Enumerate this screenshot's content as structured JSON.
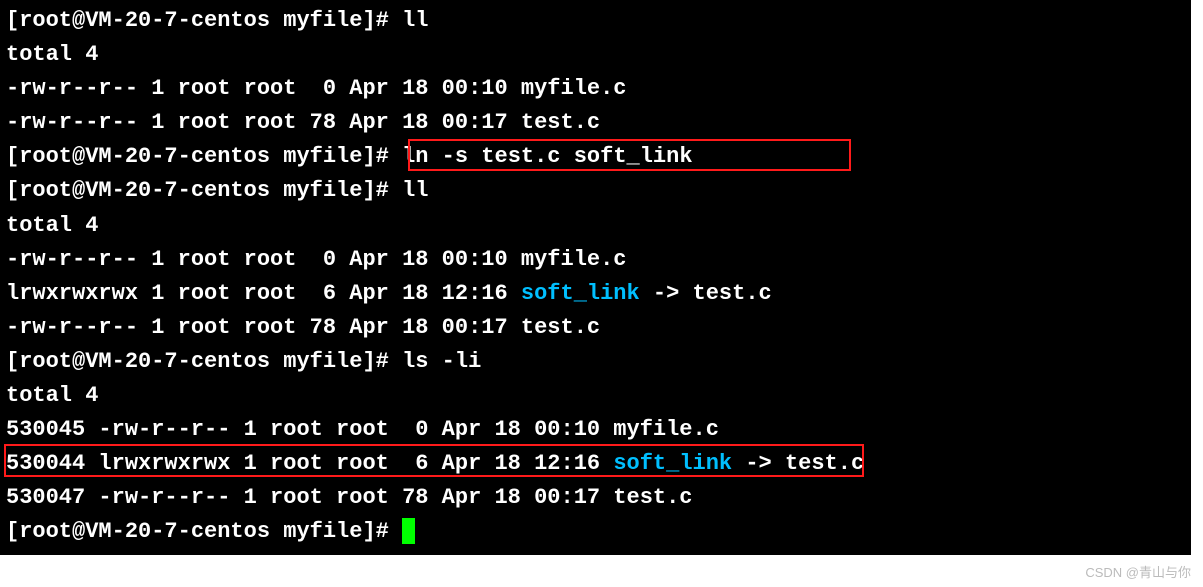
{
  "prompt": "[root@VM-20-7-centos myfile]# ",
  "cmd_ll1": "ll",
  "total": "total 4",
  "ls1_myfile": "-rw-r--r-- 1 root root  0 Apr 18 00:10 myfile.c",
  "ls1_test": "-rw-r--r-- 1 root root 78 Apr 18 00:17 test.c",
  "cmd_ln": "ln -s test.c soft_link",
  "cmd_ll2": "ll",
  "ls2_myfile": "-rw-r--r-- 1 root root  0 Apr 18 00:10 myfile.c",
  "ls2_link_a": "lrwxrwxrwx 1 root root  6 Apr 18 12:16 ",
  "ls2_link_name": "soft_link",
  "ls2_link_b": " -> test.c",
  "ls2_test": "-rw-r--r-- 1 root root 78 Apr 18 00:17 test.c",
  "cmd_lsli": "ls -li",
  "ls3_myfile": "530045 -rw-r--r-- 1 root root  0 Apr 18 00:10 myfile.c",
  "ls3_link_a": "530044 lrwxrwxrwx 1 root root  6 Apr 18 12:16 ",
  "ls3_link_name": "soft_link",
  "ls3_link_b": " -> test.c",
  "ls3_test": "530047 -rw-r--r-- 1 root root 78 Apr 18 00:17 test.c",
  "watermark": "CSDN @青山与你"
}
